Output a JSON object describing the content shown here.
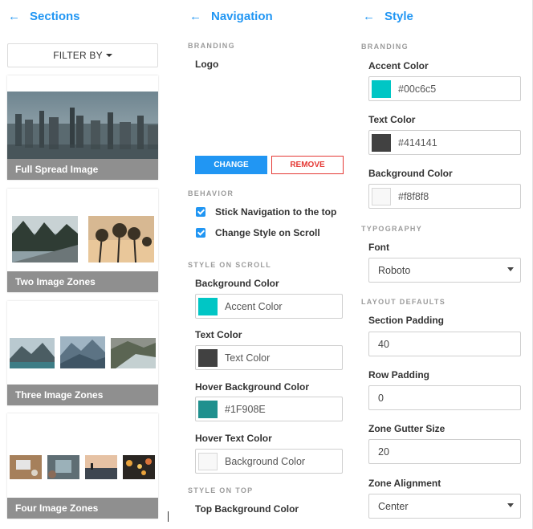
{
  "sections_panel": {
    "title": "Sections",
    "filter_label": "FILTER BY",
    "cards": [
      {
        "label": "Full Spread Image"
      },
      {
        "label": "Two Image Zones"
      },
      {
        "label": "Three Image Zones"
      },
      {
        "label": "Four Image Zones"
      }
    ]
  },
  "navigation_panel": {
    "title": "Navigation",
    "branding_title": "BRANDING",
    "logo_label": "Logo",
    "change_label": "CHANGE",
    "remove_label": "REMOVE",
    "behavior_title": "BEHAVIOR",
    "behavior": [
      {
        "label": "Stick Navigation to the top",
        "checked": true
      },
      {
        "label": "Change Style on Scroll",
        "checked": true
      }
    ],
    "style_on_scroll_title": "STYLE ON SCROLL",
    "scroll_fields": [
      {
        "label": "Background Color",
        "value": "Accent Color",
        "swatch": "#00c6c5"
      },
      {
        "label": "Text Color",
        "value": "Text Color",
        "swatch": "#414141"
      },
      {
        "label": "Hover Background Color",
        "value": "#1F908E",
        "swatch": "#1f908e"
      },
      {
        "label": "Hover Text Color",
        "value": "Background Color",
        "swatch": "#f8f8f8"
      }
    ],
    "style_on_top_title": "STYLE ON TOP",
    "top_background_label": "Top Background Color"
  },
  "style_panel": {
    "title": "Style",
    "branding_title": "BRANDING",
    "colors": [
      {
        "label": "Accent Color",
        "value": "#00c6c5",
        "swatch": "#00c6c5"
      },
      {
        "label": "Text Color",
        "value": "#414141",
        "swatch": "#414141"
      },
      {
        "label": "Background Color",
        "value": "#f8f8f8",
        "swatch": "#f8f8f8"
      }
    ],
    "typography_title": "TYPOGRAPHY",
    "font_label": "Font",
    "font_value": "Roboto",
    "layout_title": "LAYOUT DEFAULTS",
    "section_padding_label": "Section Padding",
    "section_padding_value": "40",
    "row_padding_label": "Row Padding",
    "row_padding_value": "0",
    "gutter_label": "Zone Gutter Size",
    "gutter_value": "20",
    "alignment_label": "Zone Alignment",
    "alignment_value": "Center"
  },
  "colors": {
    "accent": "#2196f3",
    "danger": "#e53935",
    "checkbox": "#2196f3"
  }
}
